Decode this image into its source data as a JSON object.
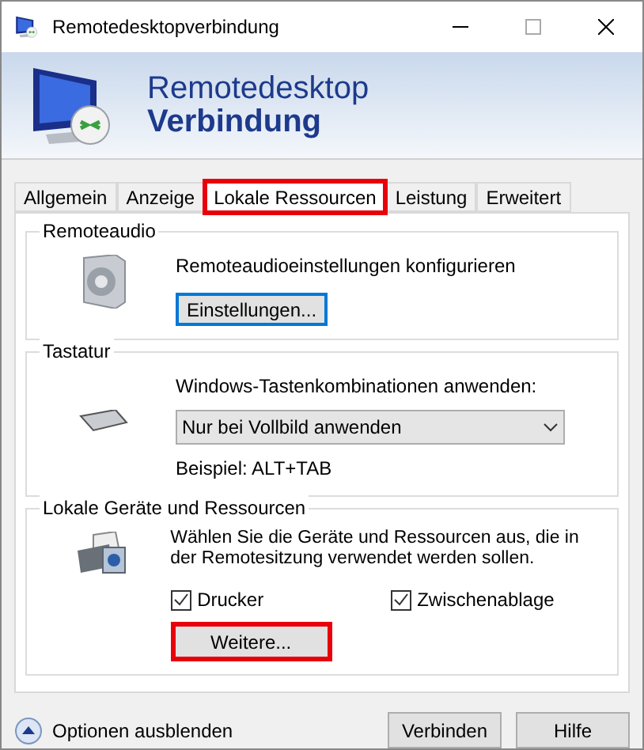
{
  "window": {
    "title": "Remotedesktopverbindung"
  },
  "banner": {
    "line_1": "Remotedesktop",
    "line_2": "Verbindung"
  },
  "tabs": [
    {
      "label": "Allgemein",
      "selected": false,
      "highlighted": false
    },
    {
      "label": "Anzeige",
      "selected": false,
      "highlighted": false
    },
    {
      "label": "Lokale Ressourcen",
      "selected": true,
      "highlighted": true
    },
    {
      "label": "Leistung",
      "selected": false,
      "highlighted": false
    },
    {
      "label": "Erweitert",
      "selected": false,
      "highlighted": false
    }
  ],
  "remote_audio": {
    "title": "Remoteaudio",
    "description": "Remoteaudioeinstellungen konfigurieren",
    "button": {
      "label": "Einstellungen...",
      "focused": true
    }
  },
  "keyboard": {
    "title": "Tastatur",
    "label": "Windows-Tastenkombinationen anwenden:",
    "dropdown": {
      "value": "Nur bei Vollbild anwenden"
    },
    "example": "Beispiel: ALT+TAB"
  },
  "local_devices": {
    "title": "Lokale Geräte und Ressourcen",
    "description": "Wählen Sie die Geräte und Ressourcen aus, die in der Remotesitzung verwendet werden sollen.",
    "checkboxes": [
      {
        "label": "Drucker",
        "checked": true
      },
      {
        "label": "Zwischenablage",
        "checked": true
      }
    ],
    "button": {
      "label": "Weitere...",
      "highlighted": true
    }
  },
  "footer": {
    "toggle": "Optionen ausblenden",
    "buttons": [
      "Verbinden",
      "Hilfe"
    ]
  }
}
